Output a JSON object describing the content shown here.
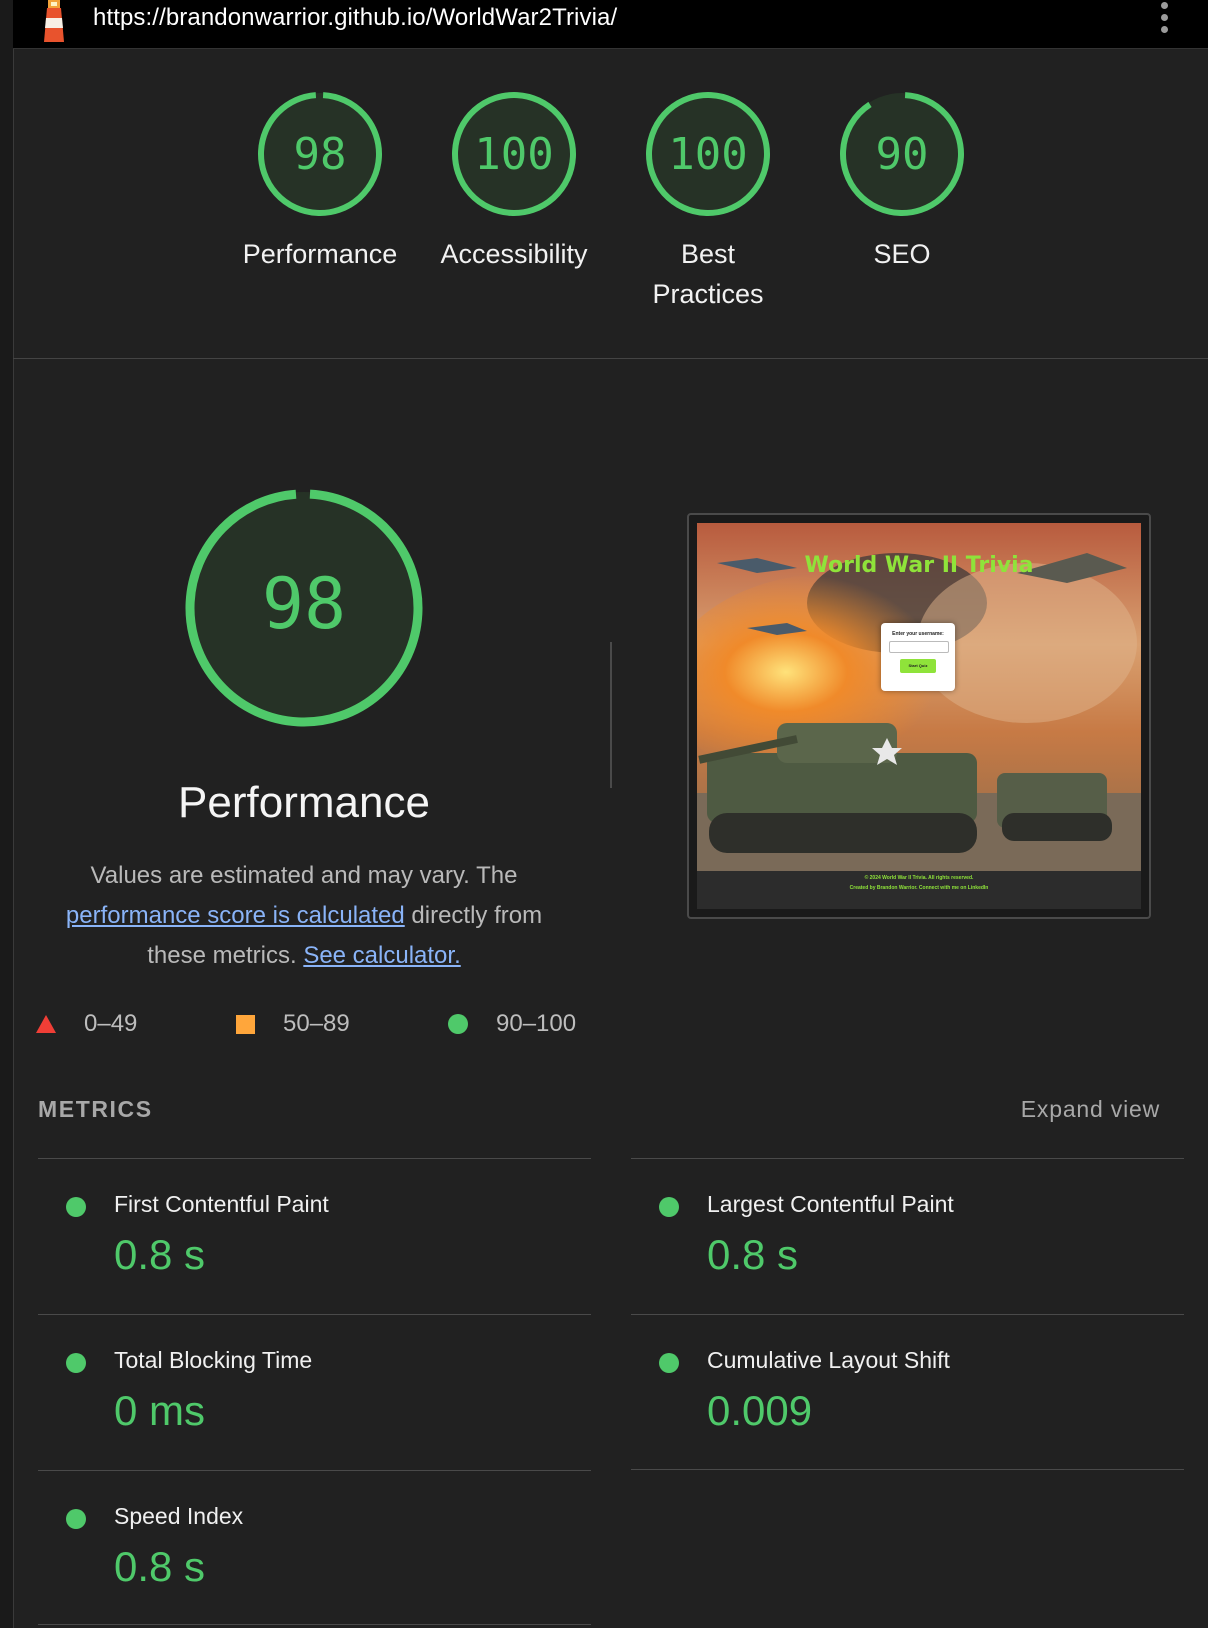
{
  "topbar": {
    "url": "https://brandonwarrior.github.io/WorldWar2Trivia/"
  },
  "gauges": [
    {
      "score": "98",
      "label": "Performance"
    },
    {
      "score": "100",
      "label": "Accessibility"
    },
    {
      "score": "100",
      "label": "Best Practices"
    },
    {
      "score": "90",
      "label": "SEO"
    }
  ],
  "performance": {
    "score": "98",
    "title": "Performance",
    "desc_prefix": "Values are estimated and may vary. The",
    "desc_link": "performance score is calculated",
    "desc_middle": "directly from these metrics.",
    "calc_link": "See calculator."
  },
  "legend": {
    "fail": "0–49",
    "average": "50–89",
    "pass": "90–100"
  },
  "screenshot": {
    "title": "World War II Trivia",
    "prompt": "Enter your username:",
    "button": "Start Quiz",
    "footer_line1": "© 2024 World War II Trivia. All rights reserved.",
    "footer_line2": "Created by Brandon Warrior. Connect with me on LinkedIn"
  },
  "metrics": {
    "heading": "METRICS",
    "expand": "Expand view",
    "items": [
      {
        "name": "First Contentful Paint",
        "value": "0.8 s"
      },
      {
        "name": "Largest Contentful Paint",
        "value": "0.8 s"
      },
      {
        "name": "Total Blocking Time",
        "value": "0 ms"
      },
      {
        "name": "Cumulative Layout Shift",
        "value": "0.009"
      },
      {
        "name": "Speed Index",
        "value": "0.8 s"
      }
    ]
  },
  "colors": {
    "pass": "#4fc96a",
    "average": "#ffa63b",
    "fail": "#f03e36",
    "background": "#212121",
    "link": "#8ab4f8"
  }
}
